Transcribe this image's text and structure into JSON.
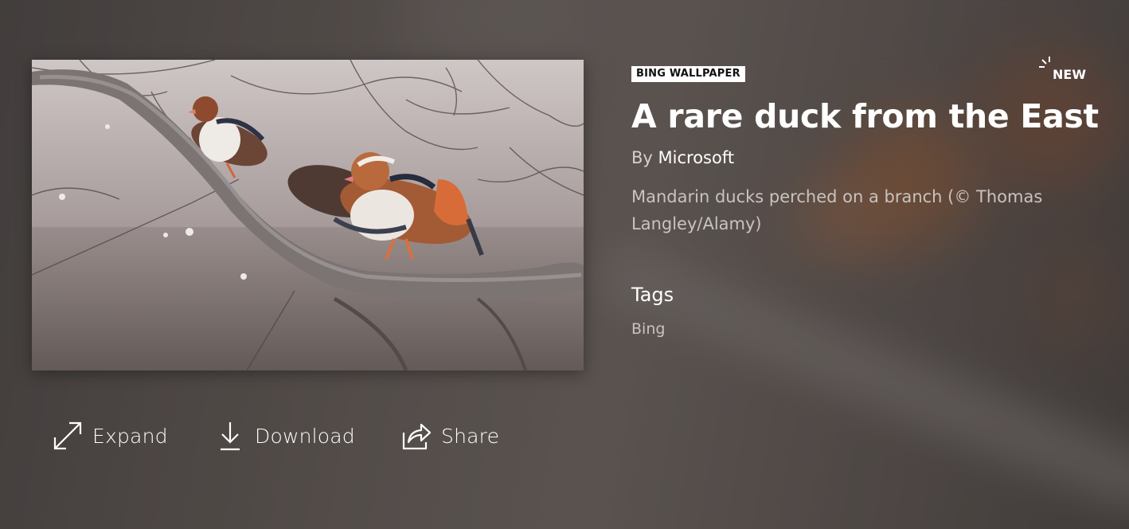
{
  "image": {
    "alt_icon": "mandarin-ducks-photo"
  },
  "actions": {
    "expand": {
      "label": "Expand",
      "icon": "expand-icon"
    },
    "download": {
      "label": "Download",
      "icon": "download-icon"
    },
    "share": {
      "label": "Share",
      "icon": "share-icon"
    }
  },
  "details": {
    "category": "BING WALLPAPER",
    "new_label": "NEW",
    "title": "A rare duck from the East",
    "by_prefix": "By",
    "author": "Microsoft",
    "caption": "Mandarin ducks perched on a branch (© Thomas Langley/Alamy)",
    "tags_heading": "Tags",
    "tags": [
      "Bing"
    ]
  },
  "colors": {
    "text": "#ffffff",
    "muted": "#c9c3bf",
    "badge_bg": "#ffffff"
  }
}
